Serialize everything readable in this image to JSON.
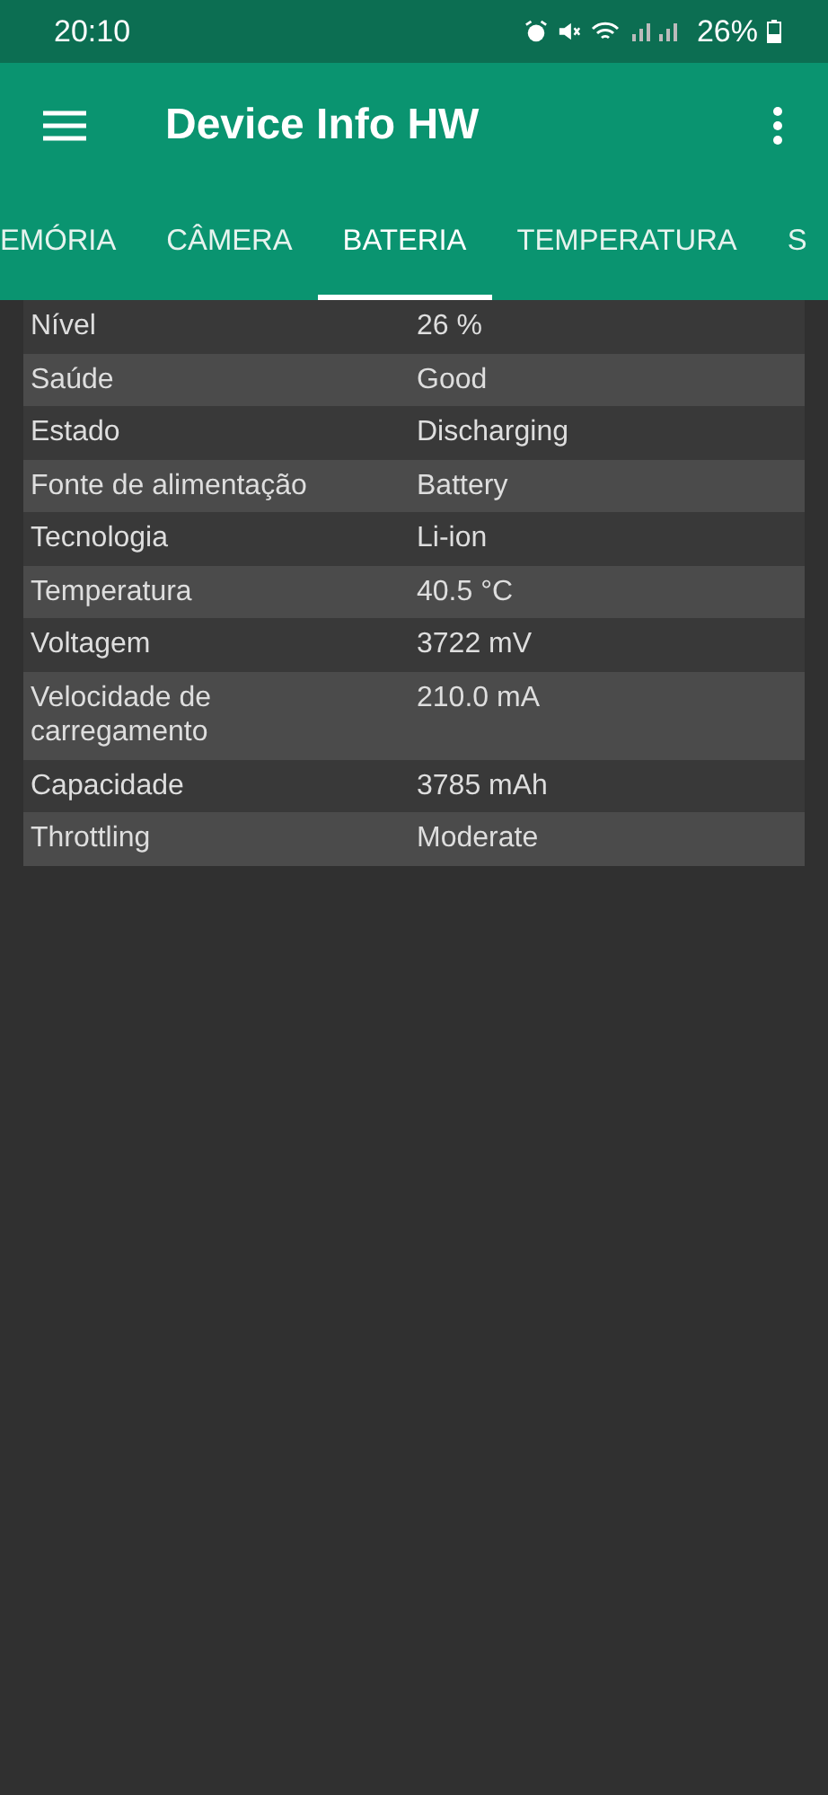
{
  "status_bar": {
    "time": "20:10",
    "battery": "26%"
  },
  "app_bar": {
    "title": "Device Info HW"
  },
  "tabs": [
    {
      "label": "EMÓRIA",
      "selected": false
    },
    {
      "label": "CÂMERA",
      "selected": false
    },
    {
      "label": "BATERIA",
      "selected": true
    },
    {
      "label": "TEMPERATURA",
      "selected": false
    },
    {
      "label": "S",
      "selected": false
    }
  ],
  "table": {
    "rows": [
      {
        "label": "Nível",
        "value": "26 %"
      },
      {
        "label": "Saúde",
        "value": "Good"
      },
      {
        "label": "Estado",
        "value": "Discharging"
      },
      {
        "label": "Fonte de alimentação",
        "value": "Battery"
      },
      {
        "label": "Tecnologia",
        "value": "Li-ion"
      },
      {
        "label": "Temperatura",
        "value": "40.5 °C"
      },
      {
        "label": "Voltagem",
        "value": "3722 mV"
      },
      {
        "label": "Velocidade de carregamento",
        "value": "210.0 mA"
      },
      {
        "label": "Capacidade",
        "value": "3785 mAh"
      },
      {
        "label": "Throttling",
        "value": "Moderate"
      }
    ]
  }
}
